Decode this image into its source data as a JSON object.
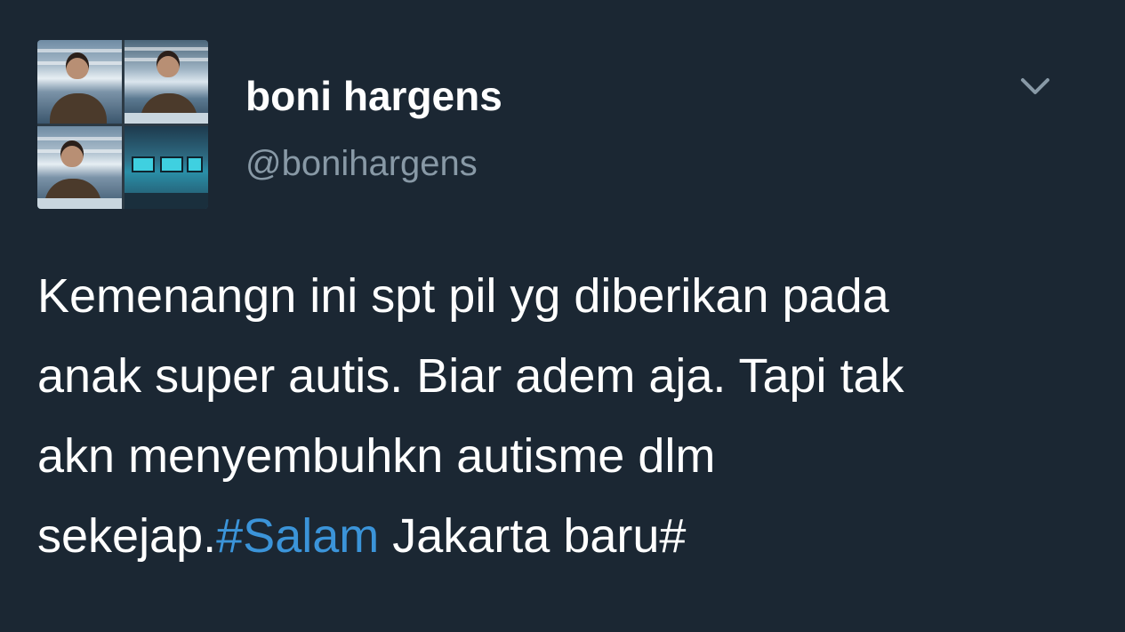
{
  "tweet": {
    "user": {
      "display_name": "boni hargens",
      "handle": "@bonihargens",
      "avatar_icon": "profile-photo-collage"
    },
    "menu_icon": "chevron-down-icon",
    "text_lines": [
      {
        "plain": "Kemenangn ini spt pil yg diberikan pada"
      },
      {
        "plain": "anak super autis. Biar adem aja. Tapi tak"
      },
      {
        "plain": "akn menyembuhkn autisme dlm"
      },
      {
        "before": "sekejap.",
        "hashtag": "#Salam",
        "after": " Jakarta baru#"
      }
    ]
  },
  "colors": {
    "background": "#1b2733",
    "text": "#ffffff",
    "handle": "#8899a6",
    "hashtag": "#3b94d9",
    "chevron": "#8899a6"
  }
}
